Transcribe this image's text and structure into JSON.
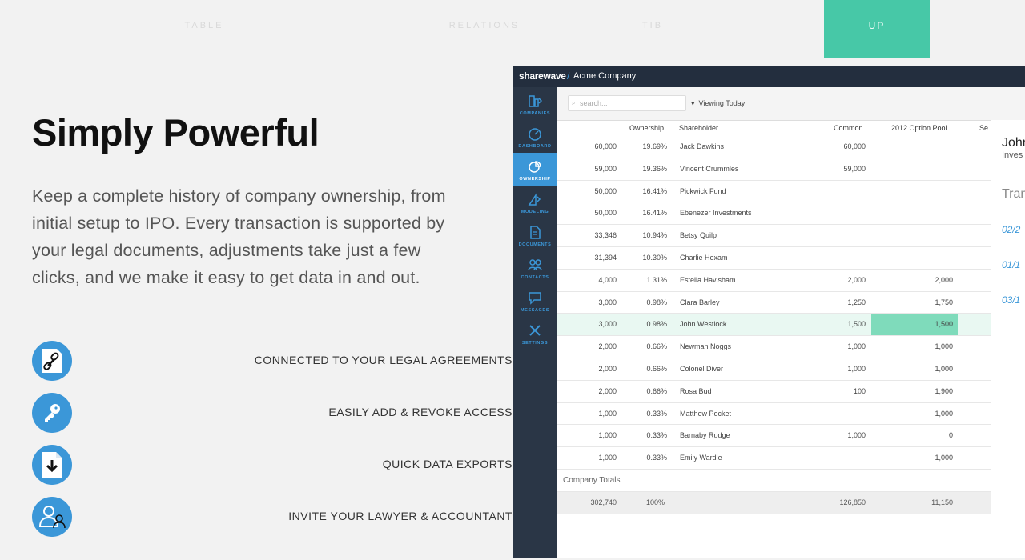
{
  "nav": {
    "items": [
      "TABLE",
      "RELATIONS",
      "TIB"
    ],
    "cta": "UP"
  },
  "hero": {
    "title": "Simply Powerful",
    "description": "Keep a complete history of company ownership, from initial setup to IPO. Every transaction is supported by your legal documents, adjustments take just a few clicks, and we make it easy to get data in and out."
  },
  "features": [
    {
      "label": "CONNECTED TO YOUR LEGAL AGREEMENTS",
      "icon": "link-document-icon"
    },
    {
      "label": "EASILY ADD & REVOKE ACCESS",
      "icon": "key-icon"
    },
    {
      "label": "QUICK DATA EXPORTS",
      "icon": "download-document-icon"
    },
    {
      "label": "INVITE YOUR LAWYER & ACCOUNTANT",
      "icon": "invite-users-icon"
    }
  ],
  "app": {
    "brand": "sharewave",
    "separator": "/",
    "company": "Acme Company",
    "sidebar": [
      {
        "label": "COMPANIES",
        "icon": "companies-icon",
        "active": false
      },
      {
        "label": "DASHBOARD",
        "icon": "dashboard-icon",
        "active": false
      },
      {
        "label": "OWNERSHIP",
        "icon": "ownership-icon",
        "active": true
      },
      {
        "label": "MODELING",
        "icon": "modeling-icon",
        "active": false
      },
      {
        "label": "DOCUMENTS",
        "icon": "documents-icon",
        "active": false
      },
      {
        "label": "CONTACTS",
        "icon": "contacts-icon",
        "active": false
      },
      {
        "label": "MESSAGES",
        "icon": "messages-icon",
        "active": false
      },
      {
        "label": "SETTINGS",
        "icon": "settings-icon",
        "active": false
      }
    ],
    "search_placeholder": "search...",
    "viewing": "Viewing Today",
    "columns": {
      "ownership": "Ownership",
      "shareholder": "Shareholder",
      "common": "Common",
      "option_pool": "2012 Option Pool",
      "extra": "Se"
    },
    "rows": [
      {
        "shares": "60,000",
        "ownership": "19.69%",
        "shareholder": "Jack Dawkins",
        "common": "60,000",
        "option": ""
      },
      {
        "shares": "59,000",
        "ownership": "19.36%",
        "shareholder": "Vincent Crummles",
        "common": "59,000",
        "option": ""
      },
      {
        "shares": "50,000",
        "ownership": "16.41%",
        "shareholder": "Pickwick Fund",
        "common": "",
        "option": ""
      },
      {
        "shares": "50,000",
        "ownership": "16.41%",
        "shareholder": "Ebenezer Investments",
        "common": "",
        "option": ""
      },
      {
        "shares": "33,346",
        "ownership": "10.94%",
        "shareholder": "Betsy Quilp",
        "common": "",
        "option": ""
      },
      {
        "shares": "31,394",
        "ownership": "10.30%",
        "shareholder": "Charlie Hexam",
        "common": "",
        "option": ""
      },
      {
        "shares": "4,000",
        "ownership": "1.31%",
        "shareholder": "Estella Havisham",
        "common": "2,000",
        "option": "2,000"
      },
      {
        "shares": "3,000",
        "ownership": "0.98%",
        "shareholder": "Clara Barley",
        "common": "1,250",
        "option": "1,750"
      },
      {
        "shares": "3,000",
        "ownership": "0.98%",
        "shareholder": "John Westlock",
        "common": "1,500",
        "option": "1,500",
        "highlight": true
      },
      {
        "shares": "2,000",
        "ownership": "0.66%",
        "shareholder": "Newman Noggs",
        "common": "1,000",
        "option": "1,000"
      },
      {
        "shares": "2,000",
        "ownership": "0.66%",
        "shareholder": "Colonel Diver",
        "common": "1,000",
        "option": "1,000"
      },
      {
        "shares": "2,000",
        "ownership": "0.66%",
        "shareholder": "Rosa Bud",
        "common": "100",
        "option": "1,900"
      },
      {
        "shares": "1,000",
        "ownership": "0.33%",
        "shareholder": "Matthew Pocket",
        "common": "",
        "option": "1,000"
      },
      {
        "shares": "1,000",
        "ownership": "0.33%",
        "shareholder": "Barnaby Rudge",
        "common": "1,000",
        "option": "0"
      },
      {
        "shares": "1,000",
        "ownership": "0.33%",
        "shareholder": "Emily Wardle",
        "common": "",
        "option": "1,000"
      }
    ],
    "totals_label": "Company Totals",
    "totals": {
      "shares": "302,740",
      "ownership": "100%",
      "common": "126,850",
      "option": "11,150"
    },
    "panel": {
      "name": "John",
      "role": "Inves",
      "section": "Tran",
      "dates": [
        "02/2",
        "01/1",
        "03/1"
      ]
    }
  }
}
